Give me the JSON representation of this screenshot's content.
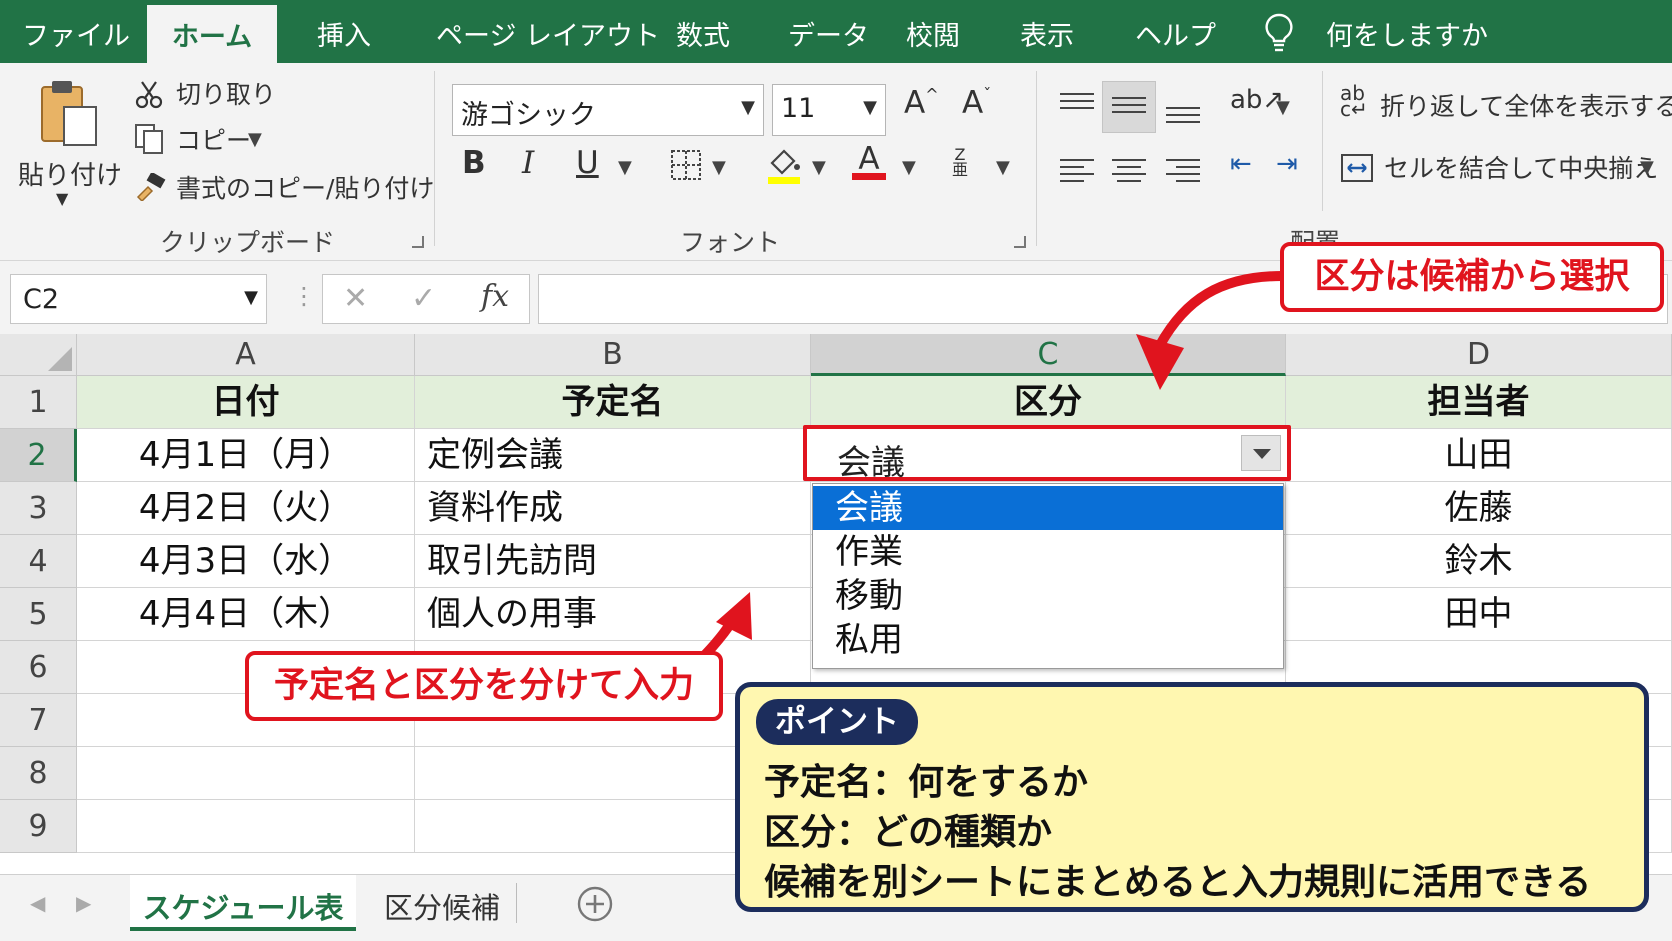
{
  "menu": {
    "tabs": [
      "ファイル",
      "ホーム",
      "挿入",
      "ページ レイアウト",
      "数式",
      "データ",
      "校閲",
      "表示",
      "ヘルプ"
    ],
    "tell_me": "何をしますか"
  },
  "ribbon": {
    "clipboard": {
      "paste": "貼り付け",
      "cut": "切り取り",
      "copy": "コピー",
      "format_painter": "書式のコピー/貼り付け",
      "label": "クリップボード"
    },
    "font": {
      "font_name": "游ゴシック",
      "font_size": "11",
      "bold": "B",
      "italic": "I",
      "underline": "U",
      "font_color_letter": "A",
      "label": "フォント",
      "highlight_color": "#ffff00",
      "text_color": "#e0141e"
    },
    "alignment": {
      "wrap_text": "折り返して全体を表示する",
      "merge_center": "セルを結合して中央揃え",
      "label": "配置"
    }
  },
  "formula_bar": {
    "name_box": "C2",
    "fx": "fx",
    "content": ""
  },
  "sheet": {
    "columns": [
      "A",
      "B",
      "C",
      "D"
    ],
    "rows": [
      "1",
      "2",
      "3",
      "4",
      "5",
      "6",
      "7",
      "8",
      "9"
    ],
    "headers": [
      "日付",
      "予定名",
      "区分",
      "担当者"
    ],
    "data": [
      {
        "date": "4月1日（月）",
        "name": "定例会議",
        "category": "会議",
        "owner": "山田"
      },
      {
        "date": "4月2日（火）",
        "name": "資料作成",
        "category": "",
        "owner": "佐藤"
      },
      {
        "date": "4月3日（水）",
        "name": "取引先訪問",
        "category": "",
        "owner": "鈴木"
      },
      {
        "date": "4月4日（木）",
        "name": "個人の用事",
        "category": "",
        "owner": "田中"
      }
    ],
    "selected_cell": "C2",
    "dropdown_options": [
      "会議",
      "作業",
      "移動",
      "私用"
    ],
    "dropdown_highlighted": "会議"
  },
  "sheet_tabs": [
    "スケジュール表",
    "区分候補"
  ],
  "annotations": {
    "top_callout": "区分は候補から選択",
    "left_callout": "予定名と区分を分けて入力",
    "point_badge": "ポイント",
    "point_lines": [
      "予定名：何をするか",
      "区分：どの種類か",
      "候補を別シートにまとめると入力規則に活用できる"
    ]
  },
  "colors": {
    "excel_green": "#217346",
    "header_fill": "#e2efda",
    "callout_red": "#e0141e",
    "point_bg": "#fff7b0",
    "point_border": "#1c2d5c",
    "selection_blue": "#0a6fd6"
  }
}
